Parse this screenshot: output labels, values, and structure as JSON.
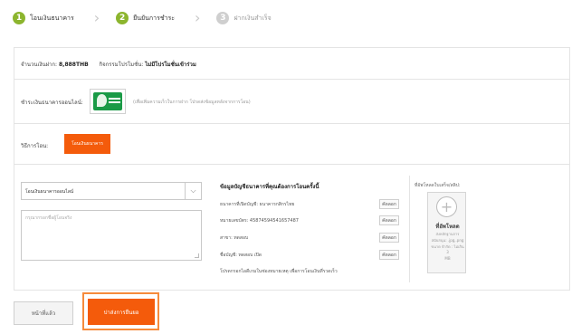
{
  "steps": [
    {
      "num": "1",
      "label": "โอนเงินธนาคาร",
      "state": "active"
    },
    {
      "num": "2",
      "label": "ยืนยันการชำระ",
      "state": "active"
    },
    {
      "num": "3",
      "label": "ฝากเงินสำเร็จ",
      "state": "inactive"
    }
  ],
  "summary": {
    "amount_label": "จำนวนเงินฝาก:",
    "amount_value": "8,888THB",
    "promo_label": "กิจกรรมโปรโมชั่น:",
    "promo_value": "ไม่มีโปรโมชั่นเข้าร่วม"
  },
  "bank": {
    "label": "ชำระเงินธนาคารออนไลน์:",
    "logo_icon": "kasikorn-bank-logo",
    "note": "(เพื่อเพิ่มความเร็วในการฝาก โปรดส่งข้อมูลหลังจากการโอน)"
  },
  "method": {
    "label": "วิธีการโอน:",
    "button": "โอนเงินธนาคาร"
  },
  "form": {
    "select_value": "โอนเงินธนาคารออนไลน์",
    "textarea_placeholder": "กรุณากรอกชื่อผู้โอนจริง"
  },
  "account_info": {
    "title": "ข้อมูลบัญชีธนาคารที่คุณต้องการโอนครั้งนี้",
    "rows": [
      {
        "text": "ธนาคารที่เปิดบัญชี: ธนาคารกสิกรไทย",
        "copy": "คัดลอก"
      },
      {
        "text": "หมายเลขบัตร: 4587459454165748​7",
        "copy": "คัดลอก"
      },
      {
        "text": "สาขา: ทดสอบ",
        "copy": "คัดลอก"
      },
      {
        "text": "ชื่อบัญชี: ทดสอบ เปิด",
        "copy": "คัดลอก"
      }
    ],
    "note": "โปรดกรอกไอดีเกมในช่องหมายเหตุ เพื่อการโอนเงินที่รวดเร็ว"
  },
  "upload": {
    "title": "ที่อัพโหลดใบเสร็จ/สลิป:",
    "label": "ที่อัพโหลด",
    "hint_lines": [
      "ส่งหลักฐานการ",
      "สนับสนุน: .jpg,.png",
      "ขนาด จำกัด : ไม่เกิน 3",
      "MB"
    ]
  },
  "actions": {
    "back": "หน้าที่แล้ว",
    "submit": "ปาส่งการยืนยอ"
  },
  "colors": {
    "accent": "#f45b0b",
    "step_active": "#8cb52e",
    "step_inactive": "#cfcfcf"
  }
}
